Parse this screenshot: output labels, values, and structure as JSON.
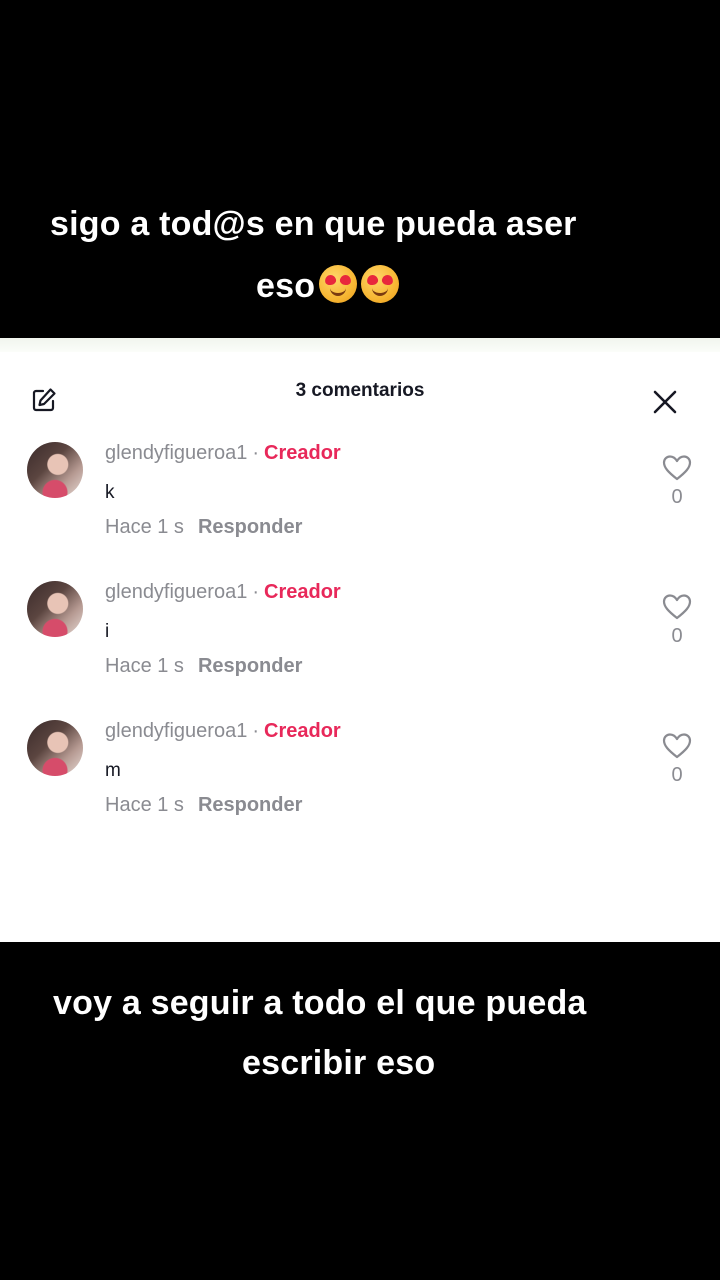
{
  "top_caption": {
    "line1": "sigo a tod@s en que pueda aser",
    "line2": "eso",
    "emojis": [
      "heart-eyes-emoji",
      "heart-eyes-emoji"
    ]
  },
  "panel": {
    "title": "3 comentarios",
    "icons": {
      "edit": "edit-icon",
      "close": "close-icon"
    }
  },
  "comments": [
    {
      "username": "glendyfigueroa1",
      "separator": "·",
      "badge": "Creador",
      "text": "k",
      "time": "Hace 1 s",
      "reply_label": "Responder",
      "likes": "0"
    },
    {
      "username": "glendyfigueroa1",
      "separator": "·",
      "badge": "Creador",
      "text": "i",
      "time": "Hace 1 s",
      "reply_label": "Responder",
      "likes": "0"
    },
    {
      "username": "glendyfigueroa1",
      "separator": "·",
      "badge": "Creador",
      "text": "m",
      "time": "Hace 1 s",
      "reply_label": "Responder",
      "likes": "0"
    }
  ],
  "bottom_caption": {
    "line1": "voy a seguir a todo el que pueda",
    "line2": "escribir eso"
  },
  "colors": {
    "background": "#000000",
    "panel": "#ffffff",
    "creator_badge": "#e8285a",
    "muted_text": "#8a8b91"
  }
}
